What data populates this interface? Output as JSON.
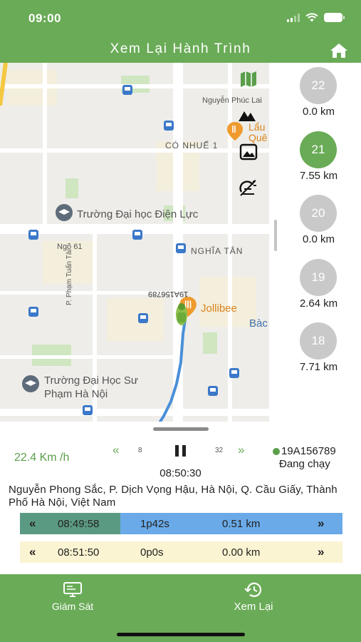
{
  "status_bar": {
    "time": "09:00"
  },
  "header": {
    "title": "Xem Lại Hành Trình"
  },
  "map": {
    "street_labels": [
      "Nguyễn Phúc Lai",
      "CÓ NHUẾ 1",
      "Ngõ 61",
      "NGHĨA TÂN",
      "P. Phạm Tuấn Tài",
      "Bàc"
    ],
    "poi_labels": [
      "Lẩu Quê",
      "Trường Đại học Điện Lực",
      "Jollibee",
      "Trường Đại Học Sư Phạm Hà Nội"
    ],
    "vehicle_plate_label": "19A156789"
  },
  "trips": [
    {
      "number": "22",
      "distance": "0.0 km",
      "active": false
    },
    {
      "number": "21",
      "distance": "7.55 km",
      "active": true
    },
    {
      "number": "20",
      "distance": "0.0 km",
      "active": false
    },
    {
      "number": "19",
      "distance": "2.64 km",
      "active": false
    },
    {
      "number": "18",
      "distance": "7.71 km",
      "active": false
    }
  ],
  "playback": {
    "speed": "22.4 Km /h",
    "rewind_step": "8",
    "forward_step": "32",
    "current_time": "08:50:30",
    "plate": "19A156789",
    "vehicle_status": "Đang chạy",
    "address": "Nguyễn Phong Sắc, P. Dịch Vọng Hậu, Hà Nội, Q. Cầu Giấy, Thành Phố Hà Nội, Việt Nam"
  },
  "segments": [
    {
      "time": "08:49:58",
      "duration": "1p42s",
      "distance": "0.51 km"
    },
    {
      "time": "08:51:50",
      "duration": "0p0s",
      "distance": "0.00 km"
    }
  ],
  "tabs": [
    {
      "label": "Giám Sát"
    },
    {
      "label": "Xem Lại"
    }
  ],
  "colors": {
    "brand_green": "#6aab57",
    "route_blue": "#4a8fd8",
    "segment_active": "#6aaae8",
    "segment_inactive": "#fbf4d2"
  }
}
